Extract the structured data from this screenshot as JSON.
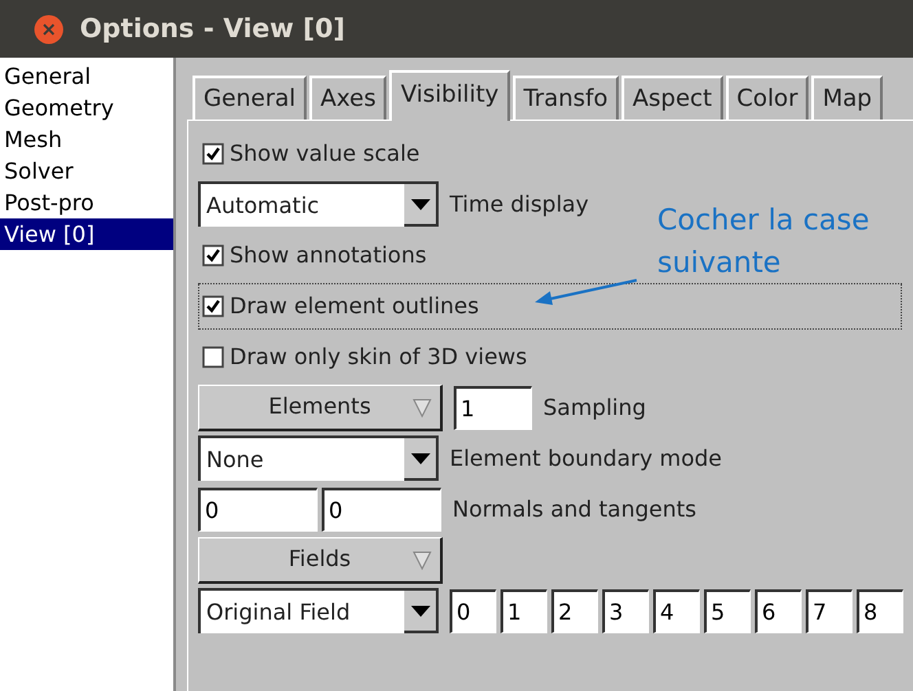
{
  "window": {
    "title": "Options - View [0]"
  },
  "sidebar": {
    "items": [
      {
        "label": "General",
        "selected": false
      },
      {
        "label": "Geometry",
        "selected": false
      },
      {
        "label": "Mesh",
        "selected": false
      },
      {
        "label": "Solver",
        "selected": false
      },
      {
        "label": "Post-pro",
        "selected": false
      },
      {
        "label": "View [0]",
        "selected": true
      }
    ]
  },
  "tabs": [
    {
      "label": "General",
      "selected": false
    },
    {
      "label": "Axes",
      "selected": false
    },
    {
      "label": "Visibility",
      "selected": true
    },
    {
      "label": "Transfo",
      "selected": false
    },
    {
      "label": "Aspect",
      "selected": false
    },
    {
      "label": "Color",
      "selected": false
    },
    {
      "label": "Map",
      "selected": false
    }
  ],
  "rows": [
    {
      "kind": "checkbox",
      "label": "Show value scale",
      "checked": true,
      "focused": false
    },
    {
      "kind": "select",
      "value": "Automatic",
      "caption": "Time display"
    },
    {
      "kind": "checkbox",
      "label": "Show annotations",
      "checked": true,
      "focused": false
    },
    {
      "kind": "checkbox",
      "label": "Draw element outlines",
      "checked": true,
      "focused": true
    },
    {
      "kind": "checkbox",
      "label": "Draw only skin of 3D views",
      "checked": false,
      "focused": false
    },
    {
      "kind": "menu",
      "button": "Elements",
      "inputs": [
        "1"
      ],
      "caption": "Sampling"
    },
    {
      "kind": "select",
      "value": "None",
      "caption": "Element boundary mode"
    },
    {
      "kind": "inputs",
      "inputs": [
        "0",
        "0"
      ],
      "caption": "Normals and tangents"
    },
    {
      "kind": "menu",
      "button": "Fields"
    },
    {
      "kind": "select",
      "value": "Original Field",
      "inputs": [
        "0",
        "1",
        "2",
        "3",
        "4",
        "5",
        "6",
        "7",
        "8"
      ]
    }
  ],
  "annotation": {
    "text": "Cocher la case suivante"
  }
}
